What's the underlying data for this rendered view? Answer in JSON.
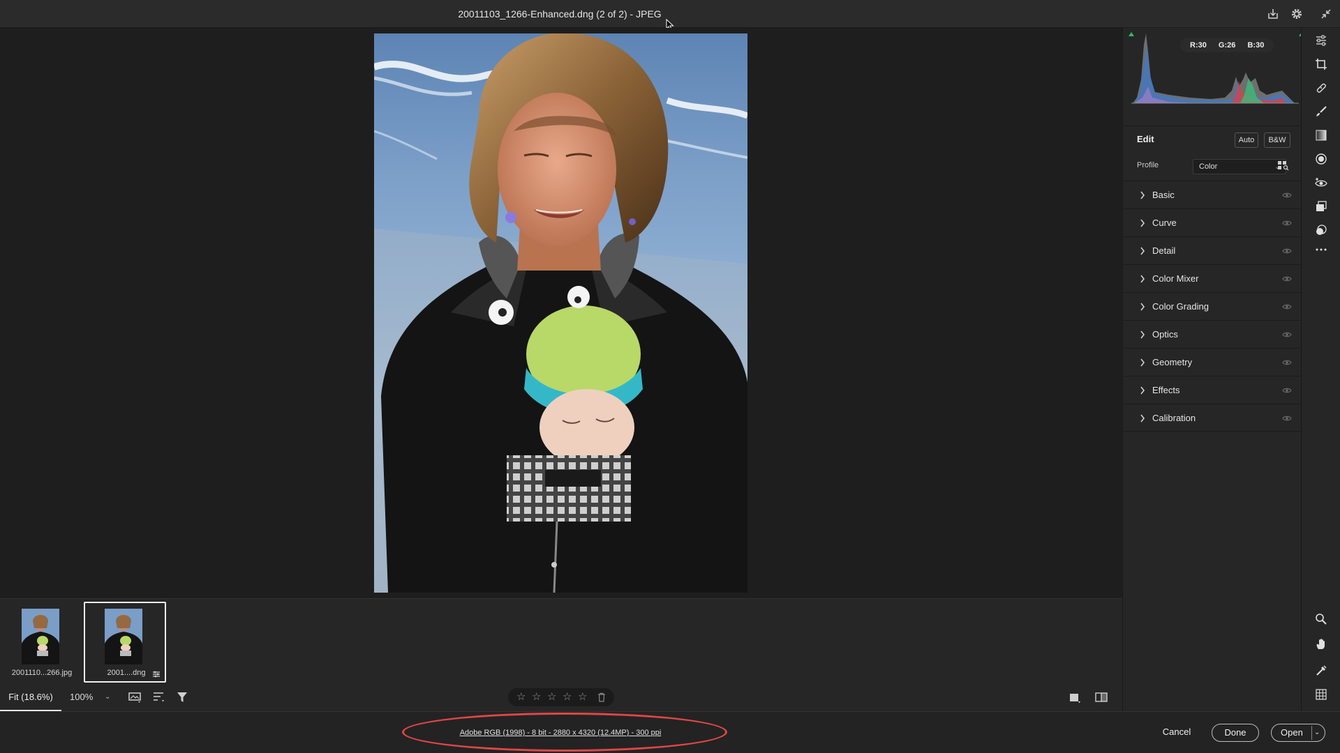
{
  "window": {
    "title": "20011103_1266-Enhanced.dng (2 of 2)  -  JPEG"
  },
  "filmstrip": {
    "thumbnails": [
      {
        "label": "2001110...266.jpg",
        "selected": false
      },
      {
        "label": "2001....dng",
        "selected": true
      }
    ]
  },
  "viewbar": {
    "fit_label": "Fit (18.6%)",
    "zoom_label": "100%",
    "rating_stars": 0
  },
  "statusbar": {
    "workflow_options": "Adobe RGB (1998) - 8 bit - 2880 x 4320 (12.4MP) - 300 ppi",
    "cancel_label": "Cancel",
    "done_label": "Done",
    "open_label": "Open"
  },
  "histogram": {
    "r_label": "R:",
    "r_value": "30",
    "g_label": "G:",
    "g_value": "26",
    "b_label": "B:",
    "b_value": "30"
  },
  "edit_panel": {
    "title": "Edit",
    "auto_label": "Auto",
    "bw_label": "B&W",
    "profile_label": "Profile",
    "profile_value": "Color",
    "sections": [
      "Basic",
      "Curve",
      "Detail",
      "Color Mixer",
      "Color Grading",
      "Optics",
      "Geometry",
      "Effects",
      "Calibration"
    ]
  },
  "colors": {
    "background": "#1e1e1e",
    "panel": "#262626",
    "annotation": "#e04646",
    "clip_indicator": "#2ebd5f"
  },
  "icons": {
    "titlebar": [
      "save-icon",
      "settings-gear-icon",
      "collapse-icon"
    ],
    "tools": [
      "edit-sliders-icon",
      "crop-icon",
      "healing-icon",
      "brush-icon",
      "linear-gradient-icon",
      "radial-gradient-icon",
      "red-eye-icon",
      "snapshots-icon",
      "presets-icon",
      "more-icon",
      "zoom-icon",
      "hand-icon",
      "color-sampler-icon",
      "grid-icon"
    ]
  }
}
